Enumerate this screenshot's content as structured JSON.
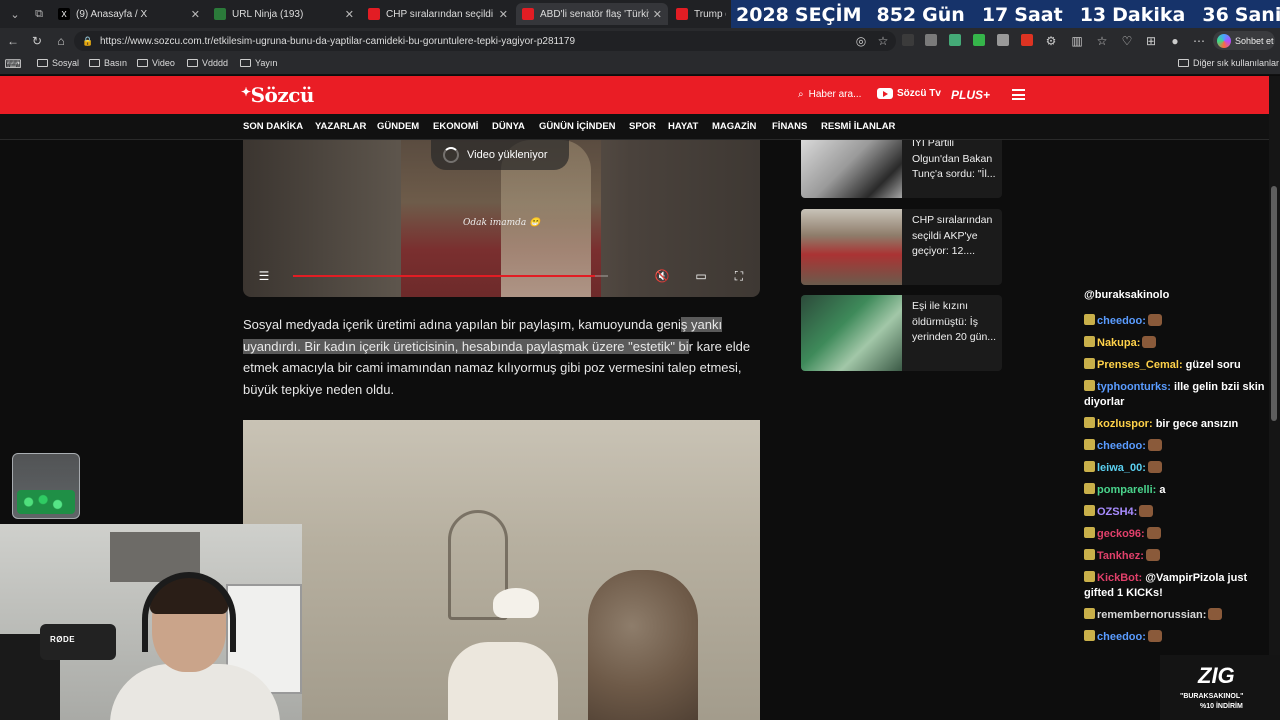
{
  "browser": {
    "tabs": [
      {
        "label": "(9) Anasayfa / X",
        "color": "#000000",
        "icon": "x-logo-icon"
      },
      {
        "label": "URL Ninja (193)",
        "color": "#2b7a3a",
        "icon": "ninja-icon"
      },
      {
        "label": "CHP sıralarından seçildi AKP'ye g",
        "color": "#e21d24",
        "icon": "sozcu-icon"
      },
      {
        "label": "ABD'li senatör flaş 'Türkiye' iddia",
        "color": "#e21d24",
        "icon": "sozcu-icon"
      },
      {
        "label": "Trump gö",
        "color": "#e21d24",
        "icon": "sozcu-icon"
      }
    ],
    "url": "https://www.sozcu.com.tr/etkilesim-ugruna-bunu-da-yaptilar-camideki-bu-goruntulere-tepki-yagiyor-p281179",
    "chat_button": "Sohbet et",
    "bookmarks": [
      "Sosyal",
      "Basın",
      "Video",
      "Vdddd",
      "Yayın"
    ],
    "other_bookmarks": "Diğer sık kullanılanlar"
  },
  "countdown": {
    "year": "2028",
    "year_label": "SEÇİM",
    "days": "852",
    "days_label": "Gün",
    "hours": "17",
    "hours_label": "Saat",
    "minutes": "13",
    "minutes_label": "Dakika",
    "seconds": "36",
    "seconds_label": "Saniye"
  },
  "site": {
    "logo": "Sözcü",
    "search": "Haber ara...",
    "tv": "Sözcü Tv",
    "plus": "PLUS+",
    "categories": [
      "SON DAKİKA",
      "YAZARLAR",
      "GÜNDEM",
      "EKONOMİ",
      "DÜNYA",
      "GÜNÜN İÇİNDEN",
      "SPOR",
      "HAYAT",
      "MAGAZİN",
      "FİNANS",
      "RESMİ İLANLAR"
    ]
  },
  "article": {
    "video_loading": "Video yükleniyor",
    "video_caption": "Odak imamda 😁",
    "progress_fraction": 0.96,
    "paragraph_before_highlight": "Sosyal medyada içerik üretimi adına yapılan bir paylaşım, kamuoyunda geni",
    "paragraph_highlight": "ş yankı uyandırdı. Bir kadın içerik üreticisinin, hesabında paylaşmak üzere \"estetik\" bi",
    "paragraph_after_highlight": "r kare elde etmek amacıyla bir cami imamından namaz kılıyormuş gibi poz vermesini talep etmesi, büyük tepkiye neden oldu."
  },
  "sidebar": {
    "news": [
      {
        "title": "İYİ Partili Olgun'dan Bakan Tunç'a sordu: \"İl..."
      },
      {
        "title": "CHP sıralarından seçildi AKP'ye geçiyor: 12...."
      },
      {
        "title": "Eşi ile kızını öldürmüştü: İş yerinden 20 gün..."
      }
    ]
  },
  "stream": {
    "channel": "@buraksakinolo",
    "messages": [
      {
        "user": "cheedoo:",
        "text": "",
        "color": "#5a9cff",
        "emote": true
      },
      {
        "user": "Nakupa:",
        "text": "",
        "color": "#ffd24a",
        "emote": true
      },
      {
        "user": "Prenses_Cemal:",
        "text": "güzel soru",
        "color": "#ffd24a",
        "emote": false
      },
      {
        "user": "typhoonturks:",
        "text": "ille gelin bzii skin diyorlar",
        "color": "#5a9cff",
        "emote": false
      },
      {
        "user": "kozluspor:",
        "text": "bir gece ansızın",
        "color": "#ffd24a",
        "emote": false
      },
      {
        "user": "cheedoo:",
        "text": "",
        "color": "#5a9cff",
        "emote": true
      },
      {
        "user": "leiwa_00:",
        "text": "",
        "color": "#5bd0f0",
        "emote": true
      },
      {
        "user": "pomparelli:",
        "text": "a",
        "color": "#4ad48c",
        "emote": false
      },
      {
        "user": "OZSH4:",
        "text": "",
        "color": "#a88cff",
        "emote": true
      },
      {
        "user": "gecko96:",
        "text": "",
        "color": "#e0406a",
        "emote": true
      },
      {
        "user": "Tankhez:",
        "text": "",
        "color": "#e0406a",
        "emote": true
      },
      {
        "user": "KickBot:",
        "text": "@VampirPizola just gifted 1 KICKs!",
        "color": "#e0406a",
        "emote": false
      },
      {
        "user": "remembernorussian:",
        "text": "",
        "color": "#d8d8d8",
        "emote": true
      },
      {
        "user": "cheedoo:",
        "text": "",
        "color": "#5a9cff",
        "emote": true
      }
    ],
    "mic_brand": "RØDE",
    "sponsor_mark": "ZIG",
    "sponsor_line1": "\"BURAKSAKINOL\"",
    "sponsor_line2": "%10 İNDİRİM"
  }
}
